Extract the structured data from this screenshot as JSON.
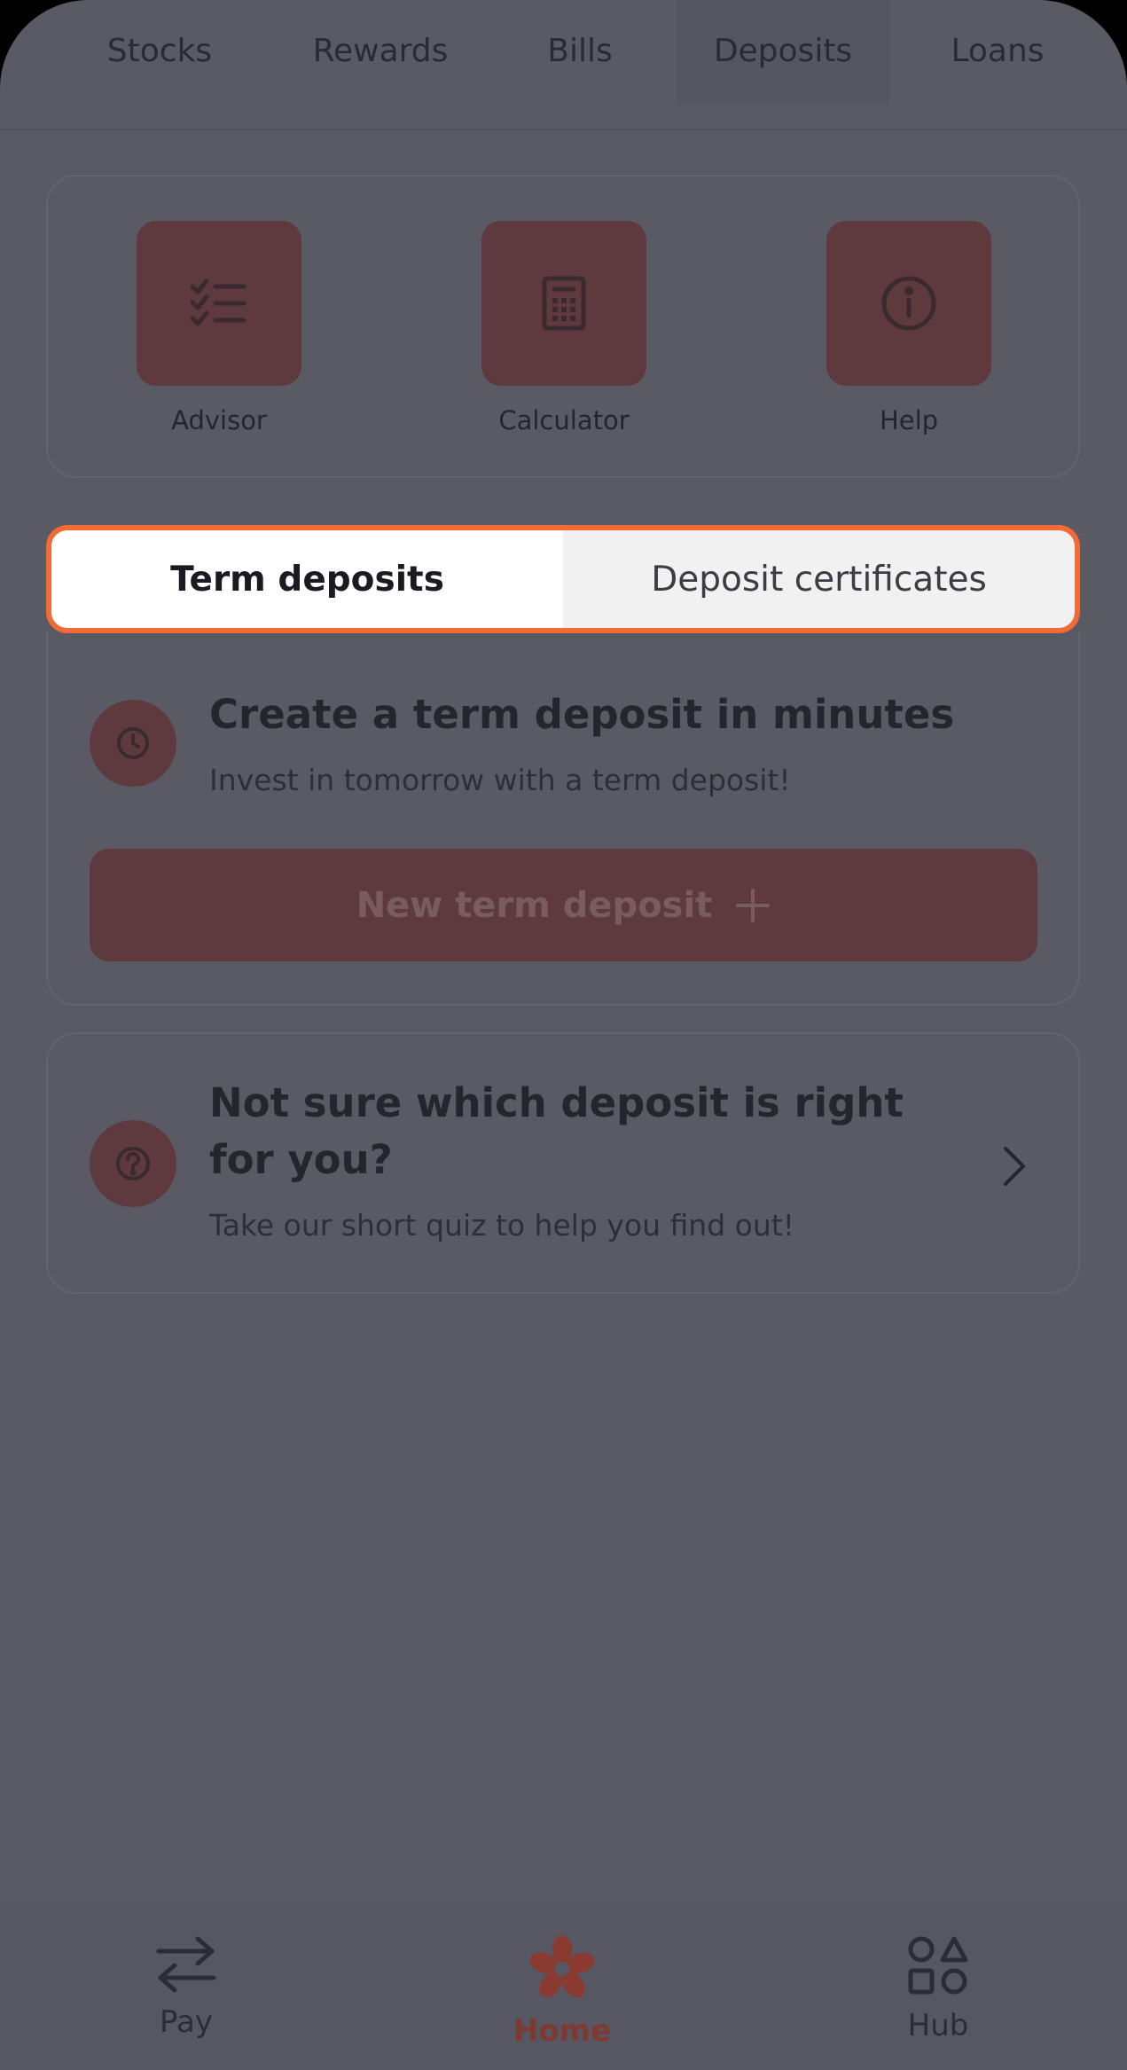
{
  "top_tabs": [
    {
      "label": "Stocks"
    },
    {
      "label": "Rewards"
    },
    {
      "label": "Bills"
    },
    {
      "label": "Deposits",
      "active": true
    },
    {
      "label": "Loans"
    }
  ],
  "quick_actions": [
    {
      "label": "Advisor",
      "icon": "checklist-icon"
    },
    {
      "label": "Calculator",
      "icon": "calculator-icon"
    },
    {
      "label": "Help",
      "icon": "info-icon"
    }
  ],
  "segmented": {
    "options": [
      {
        "label": "Term deposits",
        "selected": true
      },
      {
        "label": "Deposit certificates",
        "selected": false
      }
    ]
  },
  "term_card": {
    "title": "Create a term deposit in minutes",
    "subtitle": "Invest in tomorrow with a term deposit!",
    "button_label": "New term deposit",
    "icon": "clock-icon"
  },
  "quiz_card": {
    "title": "Not sure which deposit is right for you?",
    "subtitle": "Take our short quiz to help you find out!",
    "icon": "question-icon"
  },
  "bottom_nav": [
    {
      "label": "Pay",
      "icon": "transfer-arrows-icon"
    },
    {
      "label": "Home",
      "icon": "flower-logo-icon",
      "active": true
    },
    {
      "label": "Hub",
      "icon": "shapes-grid-icon"
    }
  ],
  "colors": {
    "highlight": "#f26a35",
    "accent_dimmed": "#5e3a3e",
    "overlay": "#5a5a65"
  }
}
